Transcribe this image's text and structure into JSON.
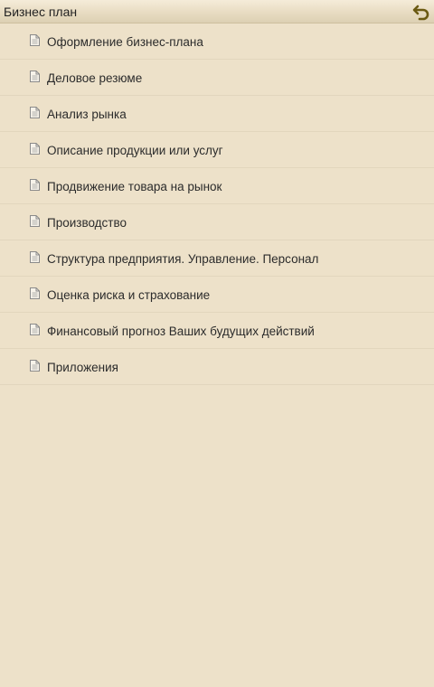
{
  "header": {
    "title": "Бизнес план",
    "back_icon": "back-arrow-icon",
    "back_icon_color": "#6b5a12"
  },
  "list": {
    "item_icon": "document-icon",
    "items": [
      {
        "label": "Оформление бизнес-плана"
      },
      {
        "label": "Деловое резюме"
      },
      {
        "label": "Анализ рынка"
      },
      {
        "label": "Описание продукции или услуг"
      },
      {
        "label": "Продвижение товара на рынок"
      },
      {
        "label": "Производство"
      },
      {
        "label": "Структура предприятия. Управление. Персонал"
      },
      {
        "label": "Оценка риска и страхование"
      },
      {
        "label": "Финансовый прогноз Ваших будущих действий"
      },
      {
        "label": "Приложения"
      }
    ]
  },
  "colors": {
    "background": "#ede1c9",
    "text": "#2b2b2b",
    "divider": "#e2d6bd"
  }
}
